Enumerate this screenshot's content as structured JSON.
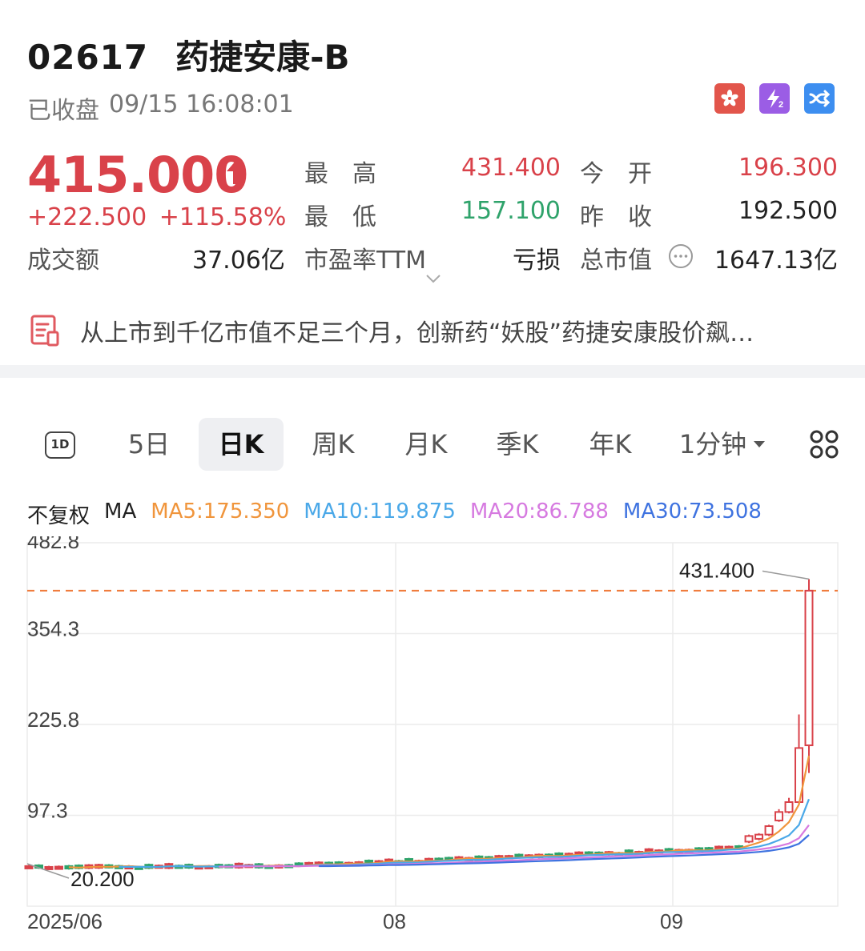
{
  "header": {
    "code": "02617",
    "name": "药捷安康-B",
    "status": "已收盘",
    "datetime": "09/15 16:08:01",
    "badges": [
      "hk-flag-icon",
      "lightning-2-icon",
      "shuffle-icon"
    ]
  },
  "quote": {
    "price": "415.000",
    "change": "+222.500",
    "change_pct": "+115.58%",
    "turnover_label": "成交额",
    "turnover": "37.06亿",
    "high_label": "最　高",
    "high": "431.400",
    "low_label": "最　低",
    "low": "157.100",
    "pe_label": "市盈率TTM",
    "pe": "亏损",
    "open_label": "今　开",
    "open": "196.300",
    "prev_close_label": "昨　收",
    "prev_close": "192.500",
    "mktcap_label": "总市值",
    "mktcap": "1647.13亿"
  },
  "news": {
    "text": "从上市到千亿市值不足三个月，创新药“妖股”药捷安康股价飙…"
  },
  "tabs": {
    "t1d": "1D",
    "t5d": "5日",
    "tday": "日K",
    "tweek": "周K",
    "tmonth": "月K",
    "tquarter": "季K",
    "tyear": "年K",
    "tmin": "1分钟"
  },
  "ma": {
    "adjust": "不复权",
    "label": "MA",
    "ma5": "MA5:175.350",
    "ma10": "MA10:119.875",
    "ma20": "MA20:86.788",
    "ma30": "MA30:73.508"
  },
  "colors": {
    "up": "#d9424a",
    "down": "#2fa36b",
    "ma5": "#f0953c",
    "ma10": "#4aa8e8",
    "ma20": "#d67ae0",
    "ma30": "#3f73e0"
  },
  "chart_data": {
    "type": "candlestick",
    "y_ticks": [
      "482.8",
      "354.3",
      "225.8",
      "97.3"
    ],
    "x_ticks": [
      "2025/06",
      "08",
      "09"
    ],
    "ylim": [
      -31.2,
      482.8
    ],
    "max_label": "431.400",
    "min_label": "20.200",
    "reference_line": 415.0,
    "candles_tail": [
      {
        "o": 60,
        "c": 68,
        "h": 70,
        "l": 58
      },
      {
        "o": 64,
        "c": 70,
        "h": 72,
        "l": 62
      },
      {
        "o": 70,
        "c": 82,
        "h": 84,
        "l": 68
      },
      {
        "o": 90,
        "c": 102,
        "h": 106,
        "l": 88
      },
      {
        "o": 102,
        "c": 116,
        "h": 122,
        "l": 100
      },
      {
        "o": 116,
        "c": 192.5,
        "h": 240,
        "l": 114
      },
      {
        "o": 196.3,
        "c": 415.0,
        "h": 431.4,
        "l": 157.1
      }
    ]
  }
}
